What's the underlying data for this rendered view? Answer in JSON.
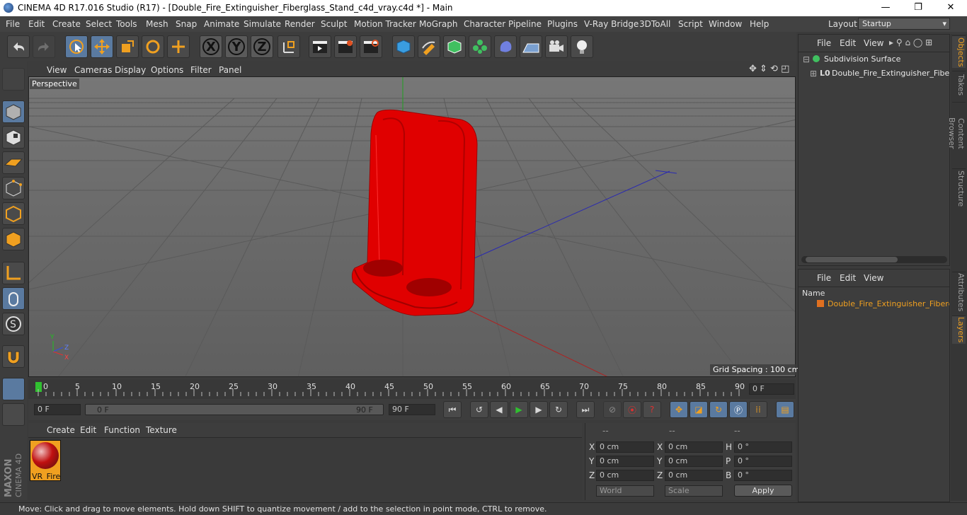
{
  "titlebar": {
    "title": "CINEMA 4D R17.016 Studio (R17) - [Double_Fire_Extinguisher_Fiberglass_Stand_c4d_vray.c4d *] - Main",
    "minimize": "—",
    "maximize": "❐",
    "close": "✕"
  },
  "menu": [
    "File",
    "Edit",
    "Create",
    "Select",
    "Tools",
    "Mesh",
    "Snap",
    "Animate",
    "Simulate",
    "Render",
    "Sculpt",
    "Motion Tracker",
    "MoGraph",
    "Character",
    "Pipeline",
    "Plugins",
    "V-Ray Bridge",
    "3DToAll",
    "Script",
    "Window",
    "Help"
  ],
  "layout": {
    "label": "Layout:",
    "value": "Startup"
  },
  "toolbar": {
    "x": "X",
    "y": "Y",
    "z": "Z"
  },
  "viewport": {
    "menu": [
      "View",
      "Cameras",
      "Display",
      "Options",
      "Filter",
      "Panel"
    ],
    "label": "Perspective",
    "grid_spacing": "Grid Spacing : 100 cm",
    "axis": {
      "y": "Y",
      "z": "Z",
      "x": "X"
    }
  },
  "timeline": {
    "ticks": [
      "0",
      "5",
      "10",
      "15",
      "20",
      "25",
      "30",
      "35",
      "40",
      "45",
      "50",
      "55",
      "60",
      "65",
      "70",
      "75",
      "80",
      "85",
      "90"
    ],
    "current_frame": "0 F"
  },
  "playback": {
    "start": "0 F",
    "range_start": "0 F",
    "range_end": "90 F",
    "end": "90 F"
  },
  "materials": {
    "menu": [
      "Create",
      "Edit",
      "Function",
      "Texture"
    ],
    "items": [
      {
        "name": "VR_Fire"
      }
    ]
  },
  "coordinates": {
    "headers": [
      "--",
      "--",
      "--"
    ],
    "rows": [
      {
        "a": "X",
        "av": "0 cm",
        "b": "X",
        "bv": "0 cm",
        "c": "H",
        "cv": "0 °"
      },
      {
        "a": "Y",
        "av": "0 cm",
        "b": "Y",
        "bv": "0 cm",
        "c": "P",
        "cv": "0 °"
      },
      {
        "a": "Z",
        "av": "0 cm",
        "b": "Z",
        "bv": "0 cm",
        "c": "B",
        "cv": "0 °"
      }
    ],
    "mode": "World",
    "scale": "Scale",
    "apply": "Apply"
  },
  "object_manager": {
    "menu": [
      "File",
      "Edit",
      "View"
    ],
    "objects": [
      "Subdivision Surface",
      "Double_Fire_Extinguisher_Fiberg"
    ],
    "lod_label": "L0"
  },
  "layer_manager": {
    "menu": [
      "File",
      "Edit",
      "View"
    ],
    "column": "Name",
    "layers": [
      "Double_Fire_Extinguisher_Fibergl"
    ]
  },
  "right_tabs": [
    "Objects",
    "Takes",
    "Content Browser",
    "Structure",
    "Attributes",
    "Layers"
  ],
  "statusbar": "Move: Click and drag to move elements. Hold down SHIFT to quantize movement / add to the selection in point mode, CTRL to remove.",
  "logo": {
    "brand": "MAXON",
    "product": "CINEMA 4D"
  },
  "colors": {
    "accent": "#f0a020",
    "object": "#e00000",
    "select": "#5a7aa0"
  }
}
